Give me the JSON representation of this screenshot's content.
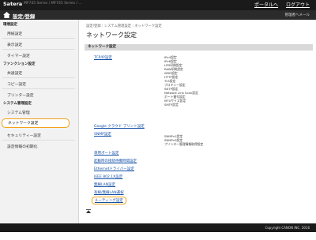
{
  "header": {
    "brand": "Satera",
    "model": "MF745 Series / MF745 Series / ...",
    "links": [
      "ポータルへ",
      "ログアウト"
    ]
  },
  "titlebar": {
    "title": "設定/登録",
    "mail": "管理者へメール"
  },
  "sidebar": {
    "sections": [
      {
        "title": "環境設定",
        "items": [
          "用紙設定",
          "表示設定",
          "タイマー設定"
        ]
      },
      {
        "title": "ファンクション設定",
        "items": [
          "共通設定",
          "コピー設定",
          "プリンター設定"
        ]
      },
      {
        "title": "システム管理設定",
        "items": [
          "システム管理",
          "ネットワーク設定",
          "セキュリティー設定",
          "設定情報の初期化"
        ]
      }
    ],
    "active": "ネットワーク設定"
  },
  "main": {
    "breadcrumb": "設定/登録 : システム管理設定 : ネットワーク設定",
    "title": "ネットワーク設定",
    "section": "ネットワーク設定",
    "tcpip": {
      "label": "TCP/IP設定",
      "subs": [
        "IPv4設定",
        "IPv6設定",
        "LPD印刷設定",
        "RAW印刷設定",
        "WSD設定",
        "HTTP設定",
        "TLS設定",
        "プロキシー設定",
        "SNTP設定",
        "Network Link Scan設定",
        "ポート番号設定",
        "MTUサイズ設定",
        "SMTP設定"
      ]
    },
    "google": "Google クラウド プリント設定",
    "snmp": {
      "label": "SNMP設定",
      "subs": [
        "SNMPv1設定",
        "SNMPv3設定",
        "プリンター管理情報取得設定"
      ]
    },
    "links": [
      "専用ポート設定",
      "起動時の接続待機時間設定",
      "Ethernetドライバー設定",
      "IEEE 802.1X設定",
      "無線LAN設定",
      "有線/無線LAN選択",
      "ルーティング設定"
    ],
    "highlighted": "ルーティング設定"
  },
  "footer": {
    "copyright": "Copyright CANON INC. 2016"
  }
}
